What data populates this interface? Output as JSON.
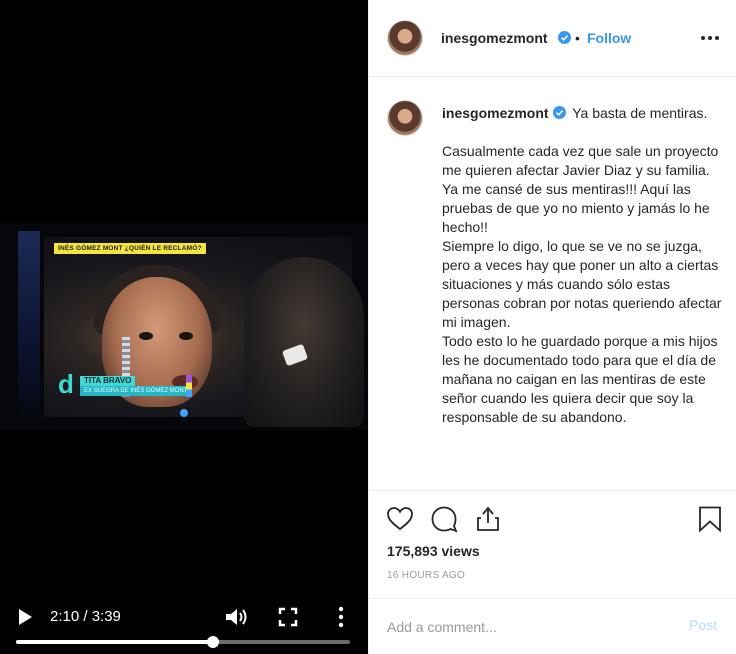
{
  "post": {
    "username": "inesgomezmont",
    "follow_label": "Follow",
    "separator": "•",
    "caption_text": "Ya basta de mentiras.\n\nCasualmente cada vez que sale un proyecto me quieren afectar Javier Diaz y su familia.\nYa me cansé de sus mentiras!!! Aquí las pruebas de que yo no miento y jamás lo he hecho!!\nSiempre lo digo, lo que se ve no se juzga, pero a veces hay que poner un alto a ciertas situaciones y más cuando sólo estas personas cobran por notas queriendo afectar mi imagen.\nTodo esto lo he guardado porque a mis hijos les he documentado todo para que el día de mañana no caigan en las mentiras de este señor cuando les quiera decir que soy la responsable de su abandono.",
    "views": "175,893 views",
    "time_ago": "16 HOURS AGO"
  },
  "video": {
    "time_display": "2:10 / 3:39",
    "progress_fraction": 0.591,
    "overlay_tag": "INÉS GÓMEZ MONT ¿QUIÉN LE RECLAMÓ?",
    "overlay_logo": "d",
    "overlay_name": "TITA BRAVO",
    "overlay_subtitle": "EX SUEGRA DE INÉS GÓMEZ MONT"
  },
  "comment": {
    "placeholder": "Add a comment...",
    "post_label": "Post"
  },
  "icons": {
    "verified": "verified-badge-icon",
    "more": "more-options-icon",
    "like": "heart-icon",
    "comment": "comment-icon",
    "share": "share-icon",
    "save": "bookmark-icon",
    "play": "play-icon",
    "volume": "volume-icon",
    "fullscreen": "fullscreen-icon",
    "video_more": "vertical-dots-icon"
  },
  "colors": {
    "accent": "#3897f0",
    "post_disabled": "#b2dffc",
    "muted": "#999999"
  }
}
